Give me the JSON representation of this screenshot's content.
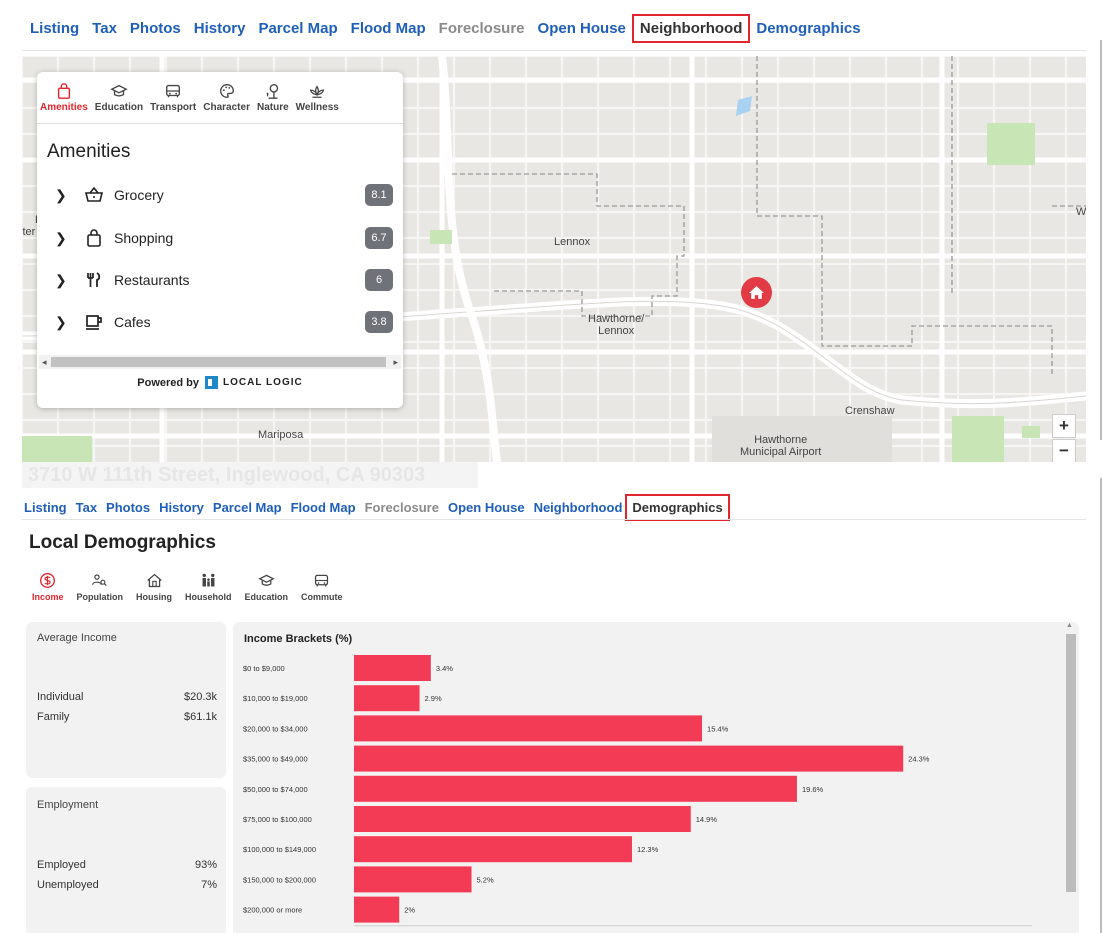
{
  "nav_top": {
    "tabs": [
      "Listing",
      "Tax",
      "Photos",
      "History",
      "Parcel Map",
      "Flood Map",
      "Foreclosure",
      "Open House",
      "Neighborhood",
      "Demographics"
    ],
    "active": "Neighborhood",
    "muted": [
      "Foreclosure"
    ]
  },
  "map": {
    "labels": {
      "lennox": "Lennox",
      "hawthorne_lennox": "Hawthorne/\nLennox",
      "crenshaw": "Crenshaw",
      "mariposa": "Mariposa",
      "airport": "Hawthorne\nMunicipal Airport",
      "edge_l": "L",
      "edge_iter": "iter",
      "edge_w": "W"
    },
    "zoom_in": "+",
    "zoom_out": "−",
    "pin_icon": "home-icon"
  },
  "local_logic": {
    "categories": [
      {
        "label": "Amenities",
        "icon": "shopping-bag-icon",
        "active": true
      },
      {
        "label": "Education",
        "icon": "graduation-cap-icon",
        "active": false
      },
      {
        "label": "Transport",
        "icon": "bus-icon",
        "active": false
      },
      {
        "label": "Character",
        "icon": "palette-icon",
        "active": false
      },
      {
        "label": "Nature",
        "icon": "tree-icon",
        "active": false
      },
      {
        "label": "Wellness",
        "icon": "lotus-icon",
        "active": false
      }
    ],
    "heading": "Amenities",
    "items": [
      {
        "label": "Grocery",
        "score": "8.1",
        "icon": "basket-icon"
      },
      {
        "label": "Shopping",
        "score": "6.7",
        "icon": "shopping-bag-icon"
      },
      {
        "label": "Restaurants",
        "score": "6",
        "icon": "fork-knife-icon"
      },
      {
        "label": "Cafes",
        "score": "3.8",
        "icon": "coffee-cup-icon"
      }
    ],
    "powered_by": "Powered by",
    "logo_text": "LOCAL LOGIC"
  },
  "ghost_address": "3710 W 111th Street, Inglewood, CA 90303",
  "nav_bottom": {
    "tabs": [
      "Listing",
      "Tax",
      "Photos",
      "History",
      "Parcel Map",
      "Flood Map",
      "Foreclosure",
      "Open House",
      "Neighborhood",
      "Demographics"
    ],
    "active": "Demographics",
    "muted": [
      "Foreclosure"
    ]
  },
  "demographics": {
    "title": "Local Demographics",
    "tabs": [
      {
        "label": "Income",
        "icon": "dollar-circle-icon",
        "active": true
      },
      {
        "label": "Population",
        "icon": "people-search-icon",
        "active": false
      },
      {
        "label": "Housing",
        "icon": "house-icon",
        "active": false
      },
      {
        "label": "Household",
        "icon": "family-icon",
        "active": false
      },
      {
        "label": "Education",
        "icon": "graduation-cap-icon",
        "active": false
      },
      {
        "label": "Commute",
        "icon": "bus-icon",
        "active": false
      }
    ],
    "average_income": {
      "heading": "Average Income",
      "rows": [
        {
          "label": "Individual",
          "value": "$20.3k"
        },
        {
          "label": "Family",
          "value": "$61.1k"
        }
      ]
    },
    "employment": {
      "heading": "Employment",
      "rows": [
        {
          "label": "Employed",
          "value": "93%"
        },
        {
          "label": "Unemployed",
          "value": "7%"
        }
      ]
    }
  },
  "chart_data": {
    "type": "bar",
    "orientation": "horizontal",
    "title": "Income Brackets (%)",
    "categories": [
      "$0 to $9,000",
      "$10,000 to $19,000",
      "$20,000 to $34,000",
      "$35,000 to $49,000",
      "$50,000 to $74,000",
      "$75,000 to $100,000",
      "$100,000 to $149,000",
      "$150,000 to $200,000",
      "$200,000 or more"
    ],
    "values": [
      3.4,
      2.9,
      15.4,
      24.3,
      19.6,
      14.9,
      12.3,
      5.2,
      2
    ],
    "value_labels": [
      "3.4%",
      "2.9%",
      "15.4%",
      "24.3%",
      "19.6%",
      "14.9%",
      "12.3%",
      "5.2%",
      "2%"
    ],
    "xlim": [
      0,
      30
    ],
    "xticks": [
      "0",
      "15%",
      "30%"
    ],
    "bar_color": "#f43b55",
    "grid": false
  },
  "colors": {
    "link": "#1f5fb8",
    "accent": "#e0262c",
    "bar": "#f43b55",
    "score_badge": "#6f7278"
  }
}
